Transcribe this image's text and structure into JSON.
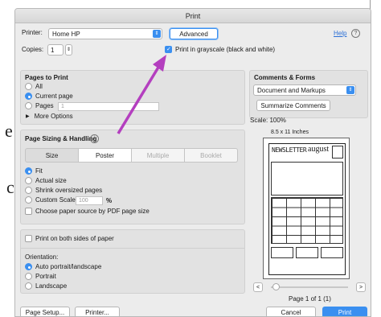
{
  "dialog": {
    "title": "Print"
  },
  "printer": {
    "label": "Printer:",
    "value": "Home HP",
    "advanced_label": "Advanced",
    "help_label": "Help"
  },
  "copies": {
    "label": "Copies:",
    "value": "1"
  },
  "grayscale": {
    "label": "Print in grayscale (black and white)",
    "checked": true
  },
  "pages_to_print": {
    "title": "Pages to Print",
    "all": "All",
    "current": "Current page",
    "pages": "Pages",
    "pages_value": "1",
    "more": "More Options"
  },
  "sizing": {
    "title": "Page Sizing & Handling",
    "tabs": [
      "Size",
      "Poster",
      "Multiple",
      "Booklet"
    ],
    "fit": "Fit",
    "actual": "Actual size",
    "shrink": "Shrink oversized pages",
    "custom": "Custom Scale:",
    "custom_value": "100",
    "custom_unit": "%",
    "paper_source": "Choose paper source by PDF page size"
  },
  "orientation": {
    "both_sides": "Print on both sides of paper",
    "title": "Orientation:",
    "auto": "Auto portrait/landscape",
    "portrait": "Portrait",
    "landscape": "Landscape"
  },
  "comments": {
    "title": "Comments & Forms",
    "value": "Document and Markups",
    "summarize": "Summarize Comments"
  },
  "preview": {
    "scale": "Scale: 100%",
    "size": "8.5 x 11 Inches",
    "doc_title": "NEWSLETTER",
    "doc_month": "august",
    "page_label": "Page 1 of 1 (1)",
    "prev": "<",
    "next": ">"
  },
  "footer": {
    "page_setup": "Page Setup...",
    "printer": "Printer...",
    "cancel": "Cancel",
    "print": "Print"
  },
  "colors": {
    "accent": "#3a8ff0",
    "arrow": "#b43fbf"
  }
}
